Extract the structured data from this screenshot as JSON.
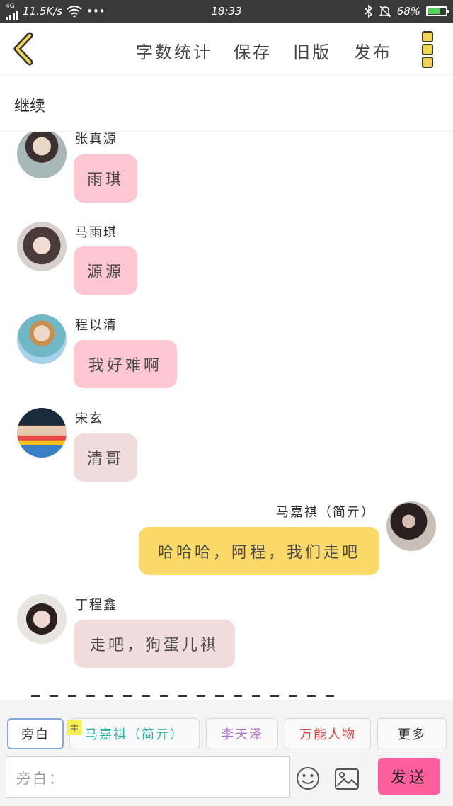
{
  "status_bar": {
    "network_type": "4G",
    "speed": "11.5K/s",
    "dots": "•••",
    "time": "18:33",
    "battery_percent": "68%",
    "battery_level": 0.68,
    "battery_color": "#4fd15a",
    "icons": [
      "signal-icon",
      "wifi-icon",
      "bluetooth-icon",
      "mute-bell-icon",
      "battery-icon"
    ]
  },
  "toolbar": {
    "word_count": "字数统计",
    "save": "保存",
    "old_version": "旧版",
    "publish": "发布"
  },
  "continue_label": "继续",
  "messages": [
    {
      "name": "张真源",
      "text": "雨琪",
      "side": "left",
      "bubble_color": "#fcc6d2",
      "avatar_color": "#8fa0a8"
    },
    {
      "name": "马雨琪",
      "text": "源源",
      "side": "left",
      "bubble_color": "#fcc6d2",
      "avatar_color": "#5a4a48"
    },
    {
      "name": "程以清",
      "text": "我好难啊",
      "side": "left",
      "bubble_color": "#fcc6d2",
      "avatar_color": "#a6c8e0"
    },
    {
      "name": "宋玄",
      "text": "清哥",
      "side": "left",
      "bubble_color": "#f1dcdc",
      "avatar_color": "#2a3a4a"
    },
    {
      "name": "马嘉祺（简亓）",
      "text": "哈哈哈，阿程，我们走吧",
      "side": "right",
      "bubble_color": "#fbd968",
      "avatar_color": "#3a3030"
    },
    {
      "name": "丁程鑫",
      "text": "走吧，狗蛋儿祺",
      "side": "left",
      "bubble_color": "#f1dcdc",
      "avatar_color": "#c8b8b0"
    }
  ],
  "role_tabs": [
    {
      "label": "旁白",
      "color": "#333333",
      "active": true
    },
    {
      "label": "马嘉祺（简亓）",
      "color": "#2bb3a0",
      "active": false,
      "tag": "主"
    },
    {
      "label": "李天泽",
      "color": "#b070d0",
      "active": false
    },
    {
      "label": "万能人物",
      "color": "#e04040",
      "active": false
    },
    {
      "label": "更多",
      "color": "#333333",
      "active": false
    }
  ],
  "input": {
    "placeholder": "旁白："
  },
  "send_label": "发送",
  "accent_colors": {
    "send": "#ff5f9c",
    "menu": "#f4d650"
  }
}
